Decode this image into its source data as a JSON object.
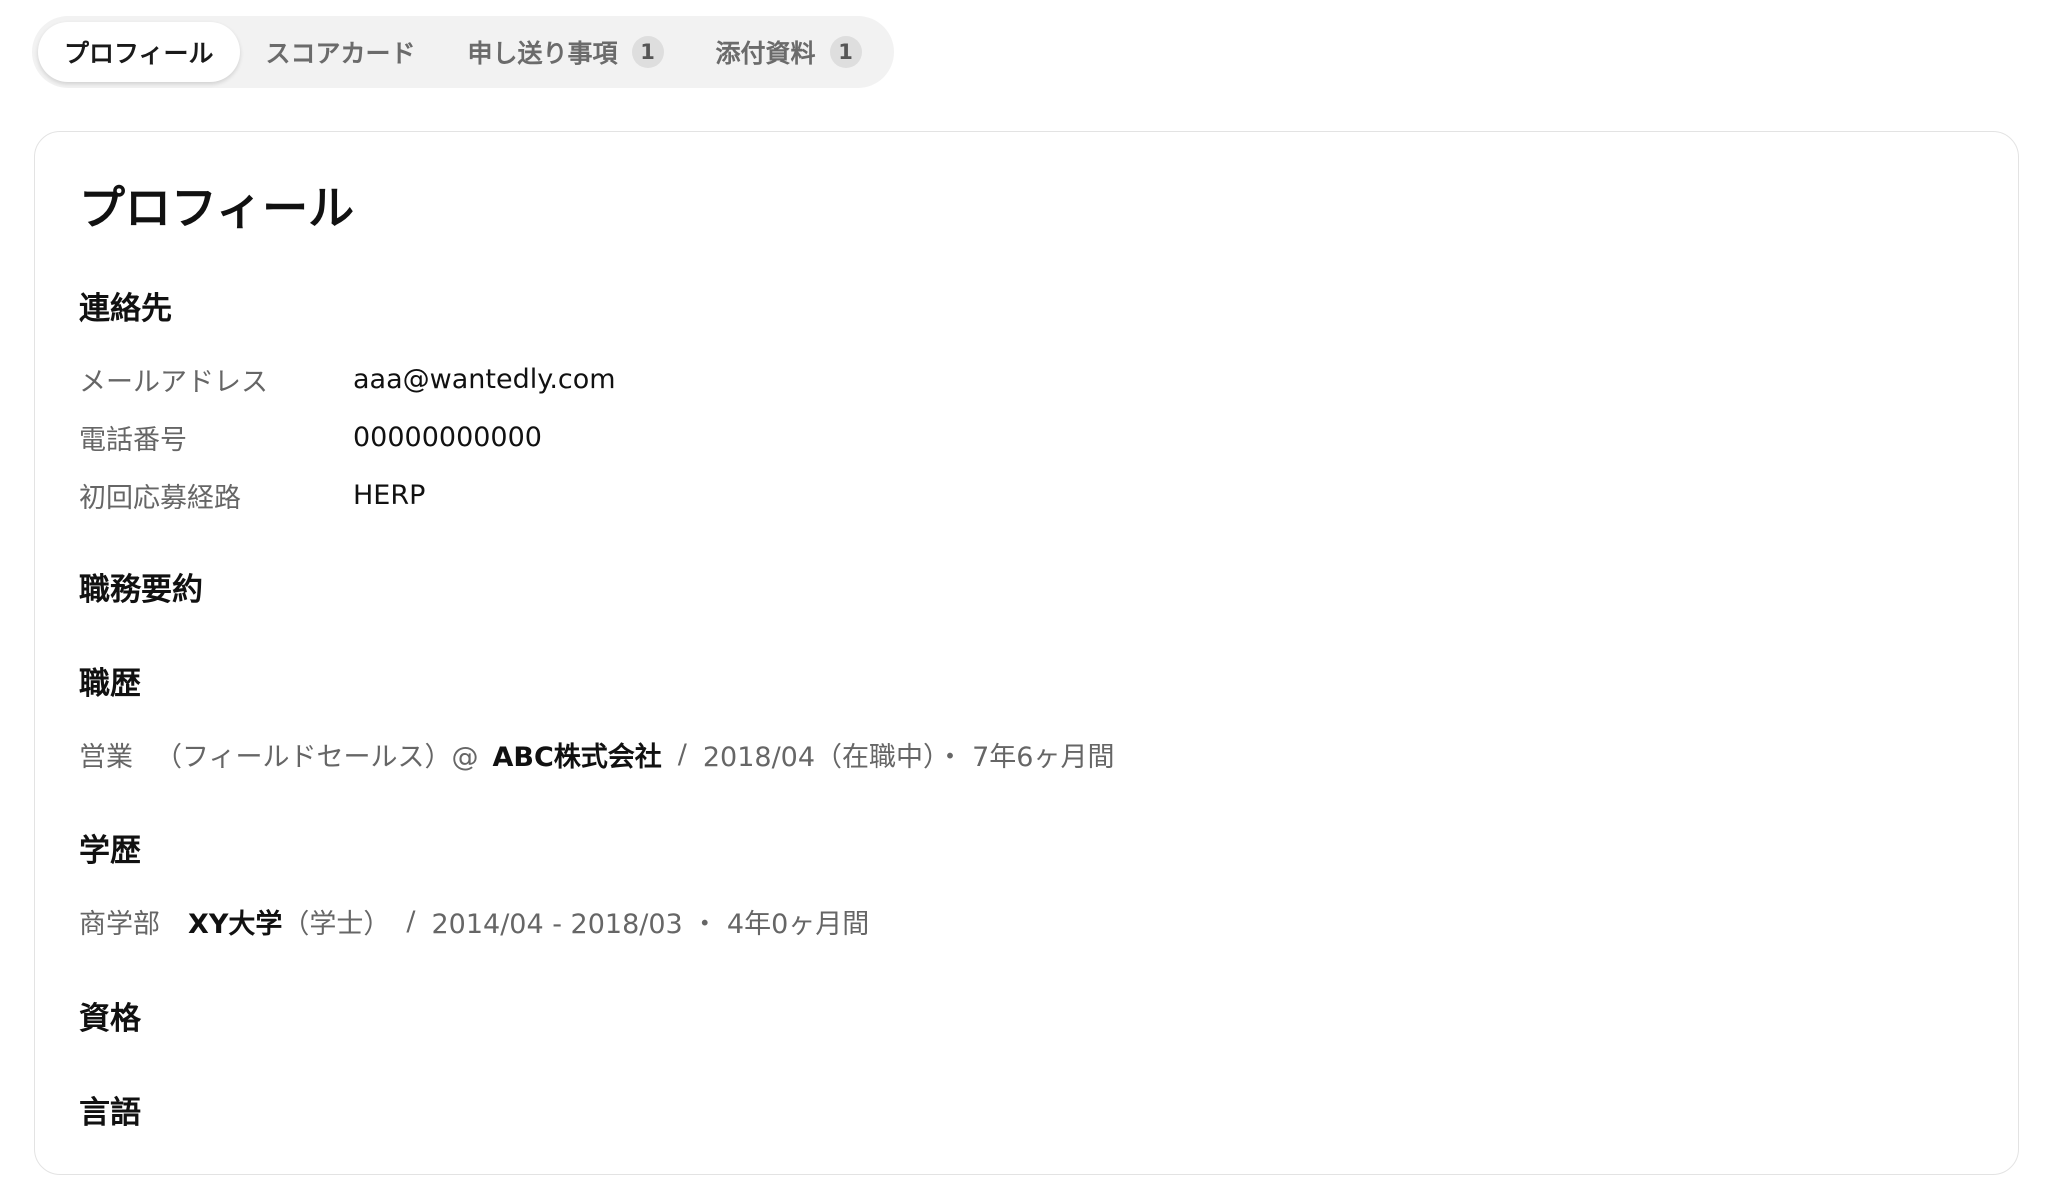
{
  "tabs": [
    {
      "label": "プロフィール",
      "active": true
    },
    {
      "label": "スコアカード",
      "active": false
    },
    {
      "label": "申し送り事項",
      "active": false,
      "badge": "1"
    },
    {
      "label": "添付資料",
      "active": false,
      "badge": "1"
    }
  ],
  "profile": {
    "title": "プロフィール",
    "contact": {
      "heading": "連絡先",
      "fields": [
        {
          "label": "メールアドレス",
          "value": "aaa@wantedly.com"
        },
        {
          "label": "電話番号",
          "value": "00000000000"
        },
        {
          "label": "初回応募経路",
          "value": "HERP"
        }
      ]
    },
    "summary": {
      "heading": "職務要約"
    },
    "career": {
      "heading": "職歴",
      "items": [
        {
          "role": "営業",
          "detail": "（フィールドセールス）@",
          "company": "ABC株式会社",
          "separator": "/",
          "period": "2018/04（在職中）・ 7年6ヶ月間"
        }
      ]
    },
    "education": {
      "heading": "学歴",
      "items": [
        {
          "faculty": "商学部",
          "school": "XY大学",
          "degree": "（学士）",
          "separator": "/",
          "period": "2014/04 - 2018/03 ・ 4年0ヶ月間"
        }
      ]
    },
    "qualifications": {
      "heading": "資格"
    },
    "languages": {
      "heading": "言語"
    }
  },
  "colors": {
    "tabbar_bg": "#f2f2f2",
    "badge_bg": "#dedede",
    "card_border": "#e3e3e3",
    "muted_text": "#666666",
    "primary_text": "#111111"
  }
}
